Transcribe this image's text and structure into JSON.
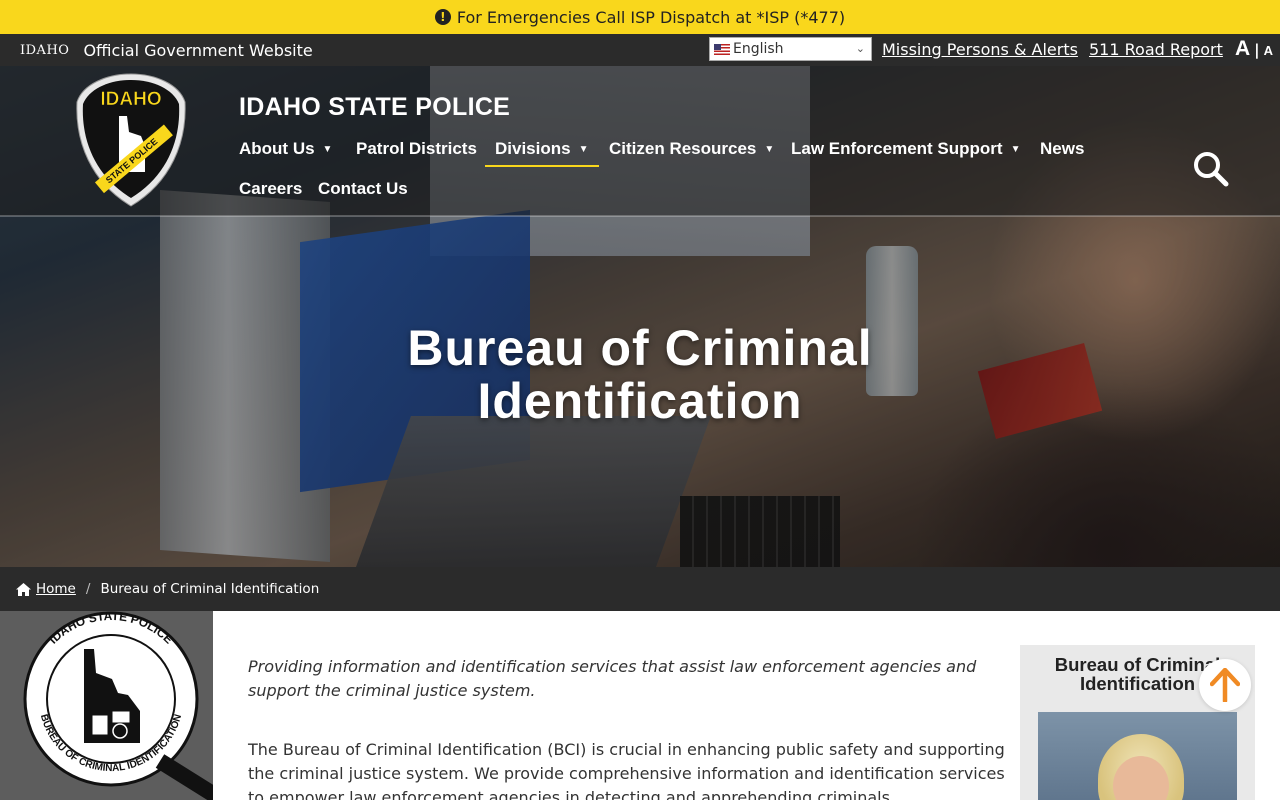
{
  "alert": {
    "icon": "exclamation-circle-icon",
    "text": "For Emergencies Call ISP Dispatch at *ISP (*477)"
  },
  "utility": {
    "idaho_mark": "IDAHO",
    "official": "Official Government Website",
    "language": "English",
    "links": [
      "Missing Persons & Alerts",
      "511 Road Report"
    ],
    "font_large": "A",
    "font_sep": "|",
    "font_small": "A"
  },
  "header": {
    "logo_top": "IDAHO",
    "logo_band": "STATE POLICE",
    "site_title": "IDAHO STATE POLICE",
    "nav": [
      {
        "label": "About Us",
        "dropdown": true
      },
      {
        "label": "Patrol Districts",
        "dropdown": false
      },
      {
        "label": "Divisions",
        "dropdown": true,
        "active": true
      },
      {
        "label": "Citizen Resources",
        "dropdown": true
      },
      {
        "label": "Law Enforcement Support",
        "dropdown": true
      },
      {
        "label": "News",
        "dropdown": false
      },
      {
        "label": "Careers",
        "dropdown": false
      },
      {
        "label": "Contact Us",
        "dropdown": false
      }
    ],
    "dropdown_glyph": "▼"
  },
  "hero": {
    "title_line1": "Bureau of Criminal",
    "title_line2": "Identification"
  },
  "breadcrumb": {
    "home": "Home",
    "separator": "/",
    "current": "Bureau of Criminal Identification"
  },
  "seal": {
    "ring_top": "IDAHO STATE POLICE",
    "ring_bottom": "BUREAU OF CRIMINAL IDENTIFICATION"
  },
  "main": {
    "lead": "Providing information and identification services that assist law enforcement agencies and support the criminal justice system.",
    "body": "The Bureau of Criminal Identification (BCI) is crucial in enhancing public safety and supporting the criminal justice system. We provide comprehensive information and identification services to empower law enforcement agencies in detecting and apprehending criminals."
  },
  "sidebar": {
    "title": "Bureau of Criminal Identification"
  },
  "colors": {
    "alert_bg": "#f9d71c",
    "dark_bar": "#2b2b2b",
    "back_to_top_arrow": "#f08a24"
  }
}
